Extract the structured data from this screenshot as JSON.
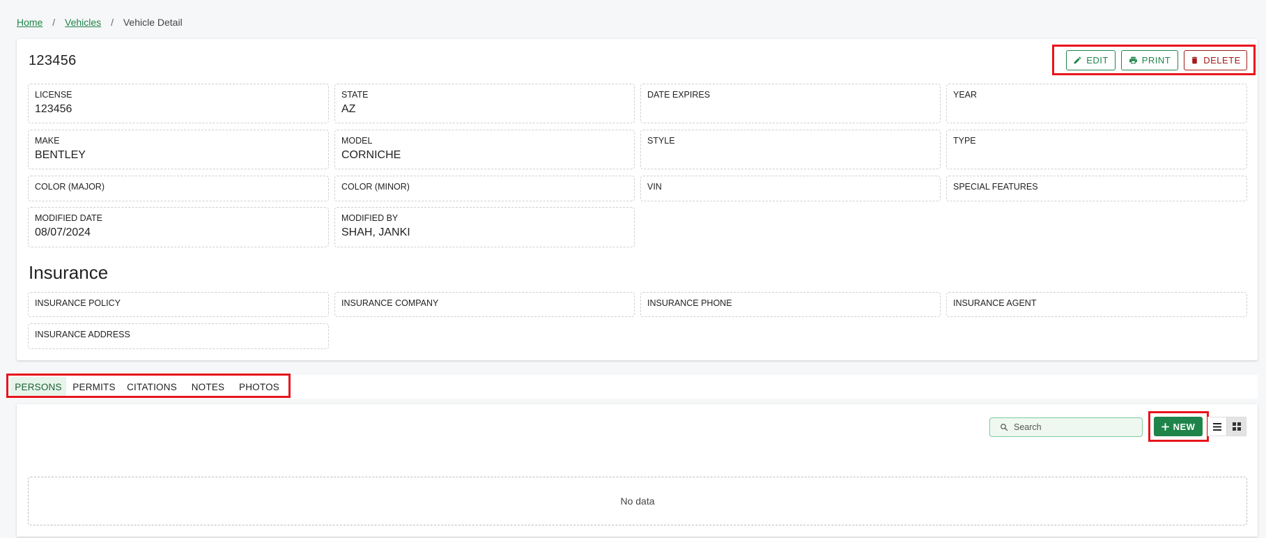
{
  "breadcrumb": {
    "home": "Home",
    "vehicles": "Vehicles",
    "current": "Vehicle Detail",
    "separator": "/"
  },
  "vehicle": {
    "title": "123456"
  },
  "actions": {
    "edit": "EDIT",
    "print": "PRINT",
    "delete": "DELETE"
  },
  "fields": {
    "license": {
      "label": "LICENSE",
      "value": "123456"
    },
    "state": {
      "label": "STATE",
      "value": "AZ"
    },
    "date_expires": {
      "label": "DATE EXPIRES",
      "value": ""
    },
    "year": {
      "label": "YEAR",
      "value": ""
    },
    "make": {
      "label": "MAKE",
      "value": "BENTLEY"
    },
    "model": {
      "label": "MODEL",
      "value": "CORNICHE"
    },
    "style": {
      "label": "STYLE",
      "value": ""
    },
    "type": {
      "label": "TYPE",
      "value": ""
    },
    "color_major": {
      "label": "COLOR (MAJOR)"
    },
    "color_minor": {
      "label": "COLOR (MINOR)"
    },
    "vin": {
      "label": "VIN"
    },
    "special_features": {
      "label": "SPECIAL FEATURES"
    },
    "modified_date": {
      "label": "MODIFIED DATE",
      "value": "08/07/2024"
    },
    "modified_by": {
      "label": "MODIFIED BY",
      "value": "SHAH, JANKI"
    }
  },
  "insurance": {
    "title": "Insurance",
    "policy": {
      "label": "INSURANCE POLICY"
    },
    "company": {
      "label": "INSURANCE COMPANY"
    },
    "phone": {
      "label": "INSURANCE PHONE"
    },
    "agent": {
      "label": "INSURANCE AGENT"
    },
    "address": {
      "label": "INSURANCE ADDRESS"
    }
  },
  "tabs": [
    {
      "label": "PERSONS",
      "active": true
    },
    {
      "label": "PERMITS"
    },
    {
      "label": "CITATIONS"
    },
    {
      "label": "NOTES"
    },
    {
      "label": "PHOTOS"
    }
  ],
  "list": {
    "search_placeholder": "Search",
    "new_label": "NEW",
    "empty_text": "No data",
    "view_mode": "grid"
  },
  "colors": {
    "accent": "#1e8449",
    "danger": "#a01a1a",
    "highlight": "#e8141c"
  },
  "icons": [
    "pencil-icon",
    "printer-icon",
    "trash-icon",
    "search-icon",
    "plus-icon",
    "list-view-icon",
    "grid-view-icon"
  ]
}
